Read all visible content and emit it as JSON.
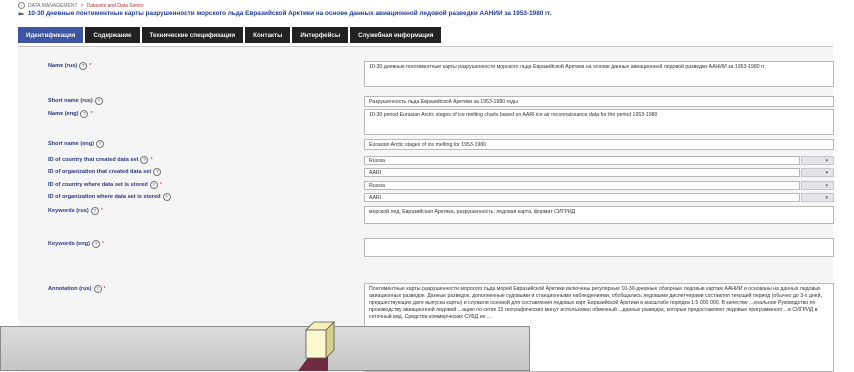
{
  "breadcrumb": {
    "home": "⌂",
    "root": "DATA MANAGEMENT",
    "sep": ">",
    "current": "Datasets and Data Series"
  },
  "page": {
    "back": "⇐",
    "title": "10-30 дневные понтиментные карты разрушенности морского льда Евразийской Арктики на основе данных авиационной ледовой разведки ААНИИ за 1953-1980 гг."
  },
  "tabs": [
    {
      "label": "Идентификация"
    },
    {
      "label": "Содержание"
    },
    {
      "label": "Технические спецификации"
    },
    {
      "label": "Контакты"
    },
    {
      "label": "Интерфейсы"
    },
    {
      "label": "Служебная информация"
    }
  ],
  "help_glyph": "?",
  "req_glyph": "*",
  "dropdown_glyph": "▾",
  "fields": {
    "name_rus": {
      "label": "Name (rus)",
      "value": "10-30 дневные понтиментные карты разрушенности морского льда Евразийской Арктики на основе данных авиационной ледовой разведки ААНИИ за 1953-1980 гг."
    },
    "short_name_rus": {
      "label": "Short name (rus)",
      "value": "Разрушенность льда Евразийской Арктики за 1953-1980 годы"
    },
    "name_eng": {
      "label": "Name (eng)",
      "value": "10-30 period Eurasian Arctic stages of ice melting charts based on AARI ice air reconnaissance data for the period 1953-1980"
    },
    "short_name_eng": {
      "label": "Short name (eng)",
      "value": "Eurasian Arctic stages of ice melting for 1953-1980"
    },
    "country_created": {
      "label": "ID of country that created data set",
      "value": "Russia"
    },
    "org_created": {
      "label": "ID of organization that created data set",
      "value": "AARI"
    },
    "country_stored": {
      "label": "ID of country where data set is stored",
      "value": "Russia"
    },
    "org_stored": {
      "label": "ID of organization where data set is stored",
      "value": "AARI"
    },
    "keywords_rus": {
      "label": "Keywords (rus)",
      "value": "морской лед, Евразийская Арктика, разрушенность, ледовая карта, формат СИГРИД"
    },
    "keywords_eng": {
      "label": "Keywords (eng)",
      "value": ""
    },
    "annotation_rus": {
      "label": "Annotation (rus)",
      "value": "Понтиментные карты разрушенности морского льда морей Евразийской Арктики включены регулярные 10-30-дневные обзорные ледовые картам ААНИИ и основаны на данных ледовых авиационных разведок. Данные разведок, дополненные судовыми и станционными наблюдениями, обобщались ледовыми диспетчерами составлял текущий период (обычно до 3-х дней, предшествующих дате выпуска карты) и служили основой для составления ледовых карт Евразийской Арктики в масштабе порядка 1:5 000 000. В качестве ...ональное Руководство по производству авиационной ледовой ...ацию по сетке 15 географических минут использован обменный ...данных разведок, которые предоставляют ледовые программного ...в СИГРИД в сеточный вид. Средства коммерческих СУБД не ..."
    }
  }
}
